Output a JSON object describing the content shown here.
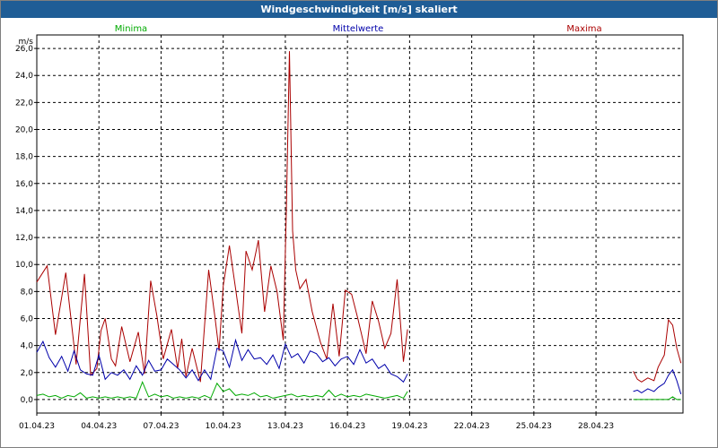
{
  "window": {
    "title": "Windgeschwindigkeit [m/s] skaliert"
  },
  "chart_data": {
    "type": "line",
    "title": "Windgeschwindigkeit [m/s] skaliert",
    "ylabel": "m/s",
    "xlabel": "",
    "ylim": [
      -1.0,
      27.0
    ],
    "xlim_days": [
      0,
      31.2
    ],
    "grid": true,
    "legend": [
      {
        "name": "Minima",
        "color": "#00aa00"
      },
      {
        "name": "Mittelwerte",
        "color": "#0000aa"
      },
      {
        "name": "Maxima",
        "color": "#aa0000"
      }
    ],
    "y_ticks": [
      "0,0",
      "2,0",
      "4,0",
      "6,0",
      "8,0",
      "10,0",
      "12,0",
      "14,0",
      "16,0",
      "18,0",
      "20,0",
      "22,0",
      "24,0",
      "26,0"
    ],
    "x_ticks": [
      "01.04.23",
      "04.04.23",
      "07.04.23",
      "10.04.23",
      "13.04.23",
      "16.04.23",
      "19.04.23",
      "22.04.23",
      "25.04.23",
      "28.04.23"
    ],
    "x_tick_days": [
      0,
      3,
      6,
      9,
      12,
      15,
      18,
      21,
      24,
      27
    ],
    "series": [
      {
        "name": "Maxima",
        "color": "#aa0000",
        "segments": [
          {
            "x": [
              0,
              0.5,
              0.9,
              1.4,
              1.9,
              2.3,
              2.6,
              2.9,
              3.1,
              3.3,
              3.6,
              3.8,
              4.1,
              4.5,
              4.9,
              5.2,
              5.5,
              5.8,
              6.1,
              6.5,
              6.8,
              7.0,
              7.2,
              7.5,
              7.9,
              8.3,
              8.6,
              8.8,
              9.0,
              9.3,
              9.6,
              9.9,
              10.1,
              10.4,
              10.7,
              11.0,
              11.3,
              11.6,
              11.9,
              12.05,
              12.2,
              12.35,
              12.5,
              12.7,
              13.0,
              13.3,
              13.7,
              14.0,
              14.3,
              14.6,
              14.9,
              15.2,
              15.5,
              15.9,
              16.2,
              16.5,
              16.8,
              17.1,
              17.4,
              17.7,
              17.9
            ],
            "y": [
              8.7,
              9.9,
              4.8,
              9.4,
              2.6,
              9.3,
              1.8,
              2.3,
              5.1,
              6.0,
              3.0,
              2.5,
              5.4,
              2.8,
              5.0,
              1.9,
              8.8,
              6.2,
              3.0,
              5.2,
              2.3,
              4.5,
              1.7,
              3.8,
              1.3,
              9.6,
              6.1,
              3.6,
              8.4,
              11.4,
              8.2,
              4.9,
              11.0,
              9.6,
              11.8,
              6.5,
              9.9,
              8.0,
              4.4,
              14.2,
              25.8,
              12.5,
              9.6,
              8.2,
              8.9,
              6.5,
              4.2,
              3.0,
              7.1,
              3.2,
              8.1,
              7.8,
              6.0,
              3.4,
              7.3,
              5.8,
              3.8,
              4.9,
              8.9,
              2.8,
              5.2
            ]
          },
          {
            "x": [
              28.8,
              29.0,
              29.2,
              29.5,
              29.8,
              30.0,
              30.3,
              30.5,
              30.7,
              30.9,
              31.1
            ],
            "y": [
              2.1,
              1.5,
              1.3,
              1.6,
              1.4,
              2.4,
              3.3,
              5.9,
              5.5,
              3.8,
              2.7
            ]
          }
        ]
      },
      {
        "name": "Mittelwerte",
        "color": "#0000aa",
        "segments": [
          {
            "x": [
              0,
              0.3,
              0.6,
              0.9,
              1.2,
              1.5,
              1.8,
              2.1,
              2.4,
              2.7,
              3.0,
              3.3,
              3.6,
              3.9,
              4.2,
              4.5,
              4.8,
              5.1,
              5.4,
              5.7,
              6.0,
              6.3,
              6.6,
              6.9,
              7.2,
              7.5,
              7.8,
              8.1,
              8.4,
              8.7,
              9.0,
              9.3,
              9.6,
              9.9,
              10.2,
              10.5,
              10.8,
              11.1,
              11.4,
              11.7,
              12.0,
              12.3,
              12.6,
              12.9,
              13.2,
              13.5,
              13.8,
              14.1,
              14.4,
              14.7,
              15.0,
              15.3,
              15.6,
              15.9,
              16.2,
              16.5,
              16.8,
              17.1,
              17.4,
              17.7,
              17.9
            ],
            "y": [
              3.5,
              4.3,
              3.1,
              2.4,
              3.2,
              2.1,
              3.6,
              2.2,
              1.9,
              1.8,
              3.3,
              1.5,
              2.0,
              1.8,
              2.2,
              1.5,
              2.5,
              1.8,
              2.9,
              2.1,
              2.2,
              3.0,
              2.6,
              2.2,
              1.6,
              2.2,
              1.4,
              2.2,
              1.5,
              3.8,
              3.6,
              2.4,
              4.4,
              2.9,
              3.7,
              3.0,
              3.1,
              2.6,
              3.3,
              2.3,
              4.1,
              3.1,
              3.4,
              2.7,
              3.6,
              3.4,
              2.8,
              3.1,
              2.5,
              3.0,
              3.2,
              2.6,
              3.7,
              2.7,
              3.0,
              2.3,
              2.6,
              1.9,
              1.7,
              1.3,
              1.9
            ]
          },
          {
            "x": [
              28.8,
              29.0,
              29.2,
              29.5,
              29.8,
              30.0,
              30.3,
              30.5,
              30.7,
              30.9,
              31.1
            ],
            "y": [
              0.6,
              0.7,
              0.5,
              0.8,
              0.6,
              0.9,
              1.2,
              1.8,
              2.2,
              1.4,
              0.4
            ]
          }
        ]
      },
      {
        "name": "Minima",
        "color": "#00aa00",
        "segments": [
          {
            "x": [
              0,
              0.3,
              0.6,
              0.9,
              1.2,
              1.5,
              1.8,
              2.1,
              2.4,
              2.7,
              3.0,
              3.3,
              3.6,
              3.9,
              4.2,
              4.5,
              4.8,
              5.1,
              5.4,
              5.7,
              6.0,
              6.3,
              6.6,
              6.9,
              7.2,
              7.5,
              7.8,
              8.1,
              8.4,
              8.7,
              9.0,
              9.3,
              9.6,
              9.9,
              10.2,
              10.5,
              10.8,
              11.1,
              11.4,
              11.7,
              12.0,
              12.3,
              12.6,
              12.9,
              13.2,
              13.5,
              13.8,
              14.1,
              14.4,
              14.7,
              15.0,
              15.3,
              15.6,
              15.9,
              16.2,
              16.5,
              16.8,
              17.1,
              17.4,
              17.7,
              17.9
            ],
            "y": [
              0.3,
              0.4,
              0.2,
              0.3,
              0.1,
              0.3,
              0.2,
              0.5,
              0.1,
              0.2,
              0.1,
              0.2,
              0.1,
              0.2,
              0.1,
              0.2,
              0.1,
              1.3,
              0.2,
              0.4,
              0.2,
              0.3,
              0.1,
              0.2,
              0.1,
              0.2,
              0.1,
              0.3,
              0.1,
              1.2,
              0.6,
              0.8,
              0.3,
              0.4,
              0.3,
              0.5,
              0.2,
              0.3,
              0.1,
              0.2,
              0.3,
              0.4,
              0.2,
              0.3,
              0.2,
              0.3,
              0.2,
              0.7,
              0.2,
              0.4,
              0.2,
              0.3,
              0.2,
              0.4,
              0.3,
              0.2,
              0.1,
              0.2,
              0.3,
              0.1,
              0.6
            ]
          },
          {
            "x": [
              28.8,
              29.0,
              29.2,
              29.5,
              29.8,
              30.0,
              30.3,
              30.5,
              30.7,
              30.9,
              31.1
            ],
            "y": [
              0.0,
              0.0,
              0.0,
              0.0,
              0.0,
              0.0,
              0.0,
              0.0,
              0.2,
              0.0,
              0.0
            ]
          }
        ]
      }
    ]
  }
}
